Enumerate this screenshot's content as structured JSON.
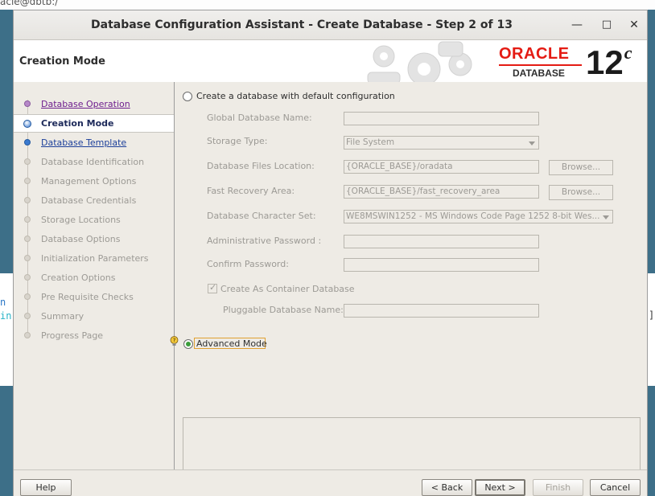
{
  "background": {
    "top_text": "acle@dbtb:/",
    "term_left_line1": "n",
    "term_left_line2": "in",
    "term_right": "]"
  },
  "window": {
    "title": "Database Configuration Assistant - Create Database - Step 2 of 13",
    "controls": {
      "minimize": "—",
      "maximize": "□",
      "close": "✕"
    }
  },
  "header": {
    "page_title": "Creation Mode",
    "brand": "ORACLE",
    "product": "DATABASE",
    "version": "12",
    "version_suffix": "c"
  },
  "steps": [
    {
      "label": "Database Operation",
      "state": "visited"
    },
    {
      "label": "Creation Mode",
      "state": "current"
    },
    {
      "label": "Database Template",
      "state": "link"
    },
    {
      "label": "Database Identification",
      "state": "disabled"
    },
    {
      "label": "Management Options",
      "state": "disabled"
    },
    {
      "label": "Database Credentials",
      "state": "disabled"
    },
    {
      "label": "Storage Locations",
      "state": "disabled"
    },
    {
      "label": "Database Options",
      "state": "disabled"
    },
    {
      "label": "Initialization Parameters",
      "state": "disabled"
    },
    {
      "label": "Creation Options",
      "state": "disabled"
    },
    {
      "label": "Pre Requisite Checks",
      "state": "disabled"
    },
    {
      "label": "Summary",
      "state": "disabled"
    },
    {
      "label": "Progress Page",
      "state": "disabled"
    }
  ],
  "options": {
    "default_config_label": "Create a database with default configuration",
    "default_config_selected": false,
    "advanced_label": "Advanced Mode",
    "advanced_selected": true
  },
  "form": {
    "global_db_name_label": "Global Database Name:",
    "global_db_name_value": "",
    "storage_type_label": "Storage Type:",
    "storage_type_value": "File System",
    "db_files_location_label": "Database Files Location:",
    "db_files_location_value": "{ORACLE_BASE}/oradata",
    "fast_recovery_label": "Fast Recovery Area:",
    "fast_recovery_value": "{ORACLE_BASE}/fast_recovery_area",
    "charset_label": "Database Character Set:",
    "charset_value": "WE8MSWIN1252 - MS Windows Code Page 1252 8-bit Wes...",
    "admin_password_label": "Administrative Password :",
    "admin_password_value": "",
    "confirm_password_label": "Confirm Password:",
    "confirm_password_value": "",
    "container_db_label": "Create As Container Database",
    "container_db_checked": true,
    "pluggable_db_label": "Pluggable Database Name:",
    "pluggable_db_value": "",
    "browse_label": "Browse..."
  },
  "footer": {
    "help": "Help",
    "back": "< Back",
    "next": "Next >",
    "finish": "Finish",
    "cancel": "Cancel"
  }
}
